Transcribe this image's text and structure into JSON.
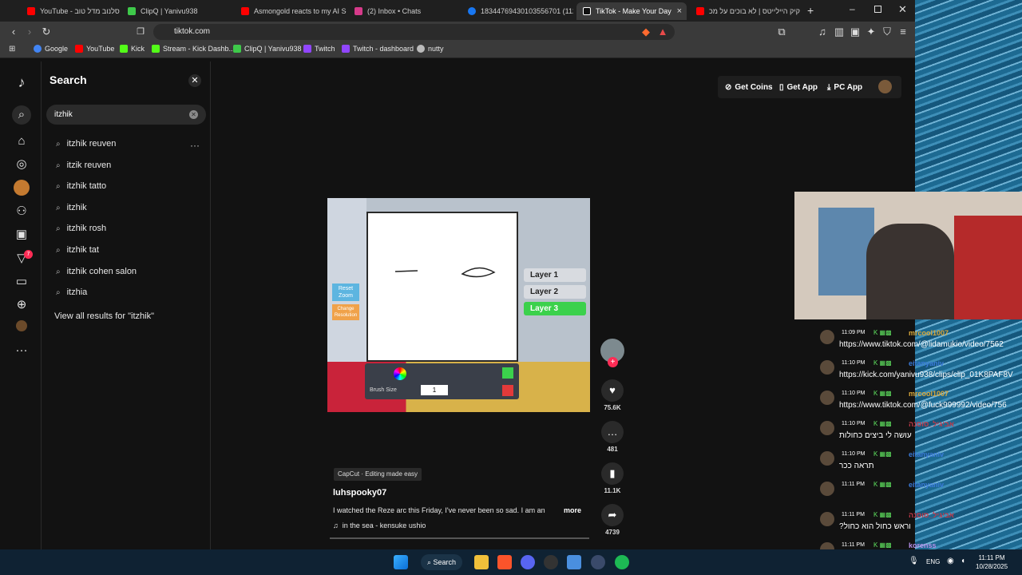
{
  "tabs": [
    {
      "label": "YouTube - גיא אסלנוב מדל טוב",
      "color": "#ff0000"
    },
    {
      "label": "ClipQ | Yanivu938",
      "color": "#3ec94a"
    },
    {
      "label": "Asmongold reacts to my AI So",
      "color": "#ff0000"
    },
    {
      "label": "(2) Inbox • Chats",
      "color": "#d63a8a"
    },
    {
      "label": "1834476943010355670​1 (112~",
      "color": "#1877f2"
    },
    {
      "label": "TikTok - Make Your Day",
      "color": "#ffffff"
    },
    {
      "label": "קיק היילייטס | לא בוכים על מכ",
      "color": "#ff0000"
    }
  ],
  "active_tab_close": "×",
  "address": {
    "url": "tiktok.com"
  },
  "bookmarks": [
    {
      "label": "Google",
      "color": "#4285f4"
    },
    {
      "label": "YouTube",
      "color": "#ff0000"
    },
    {
      "label": "Kick",
      "color": "#53fc18"
    },
    {
      "label": "Stream - Kick Dashb...",
      "color": "#53fc18"
    },
    {
      "label": "ClipQ | Yanivu938",
      "color": "#3ec94a"
    },
    {
      "label": "Twitch",
      "color": "#9146ff"
    },
    {
      "label": "Twitch - dashboard",
      "color": "#9146ff"
    },
    {
      "label": "nutty",
      "color": "#bbbbbb"
    }
  ],
  "rail": {
    "inbox_badge": "7"
  },
  "search": {
    "title": "Search",
    "query": "itzhik",
    "suggestions": [
      "itzhik reuven",
      "itzik reuven",
      "itzhik tatto",
      "itzhik",
      "itzhik rosh",
      "itzhik tat",
      "itzhik cohen salon",
      "itzhia"
    ],
    "view_all": "View all results for \"itzhik\""
  },
  "header": {
    "coins": "Get Coins",
    "app": "Get App",
    "pc_app": "PC App"
  },
  "video": {
    "layers": [
      "Layer 1",
      "Layer 2",
      "Layer 3"
    ],
    "reset_zoom": "Reset Zoom",
    "change_resolution": "Change Resolution",
    "brush_size_label": "Brush Size",
    "brush_size": "1"
  },
  "actions": {
    "likes": "75.6K",
    "comments": "481",
    "saves": "11.1K",
    "shares": "4739"
  },
  "post": {
    "capcut": "CapCut · Editing made easy",
    "author": "luhspooky07",
    "description": "I watched the Reze arc this Friday, I've never been so sad. I am an",
    "more": "more",
    "music": "in the sea - kensuke ushio"
  },
  "chat": [
    {
      "time": "11:09 PM",
      "name": "mrcool1007",
      "name_color": "#d9a83a",
      "text": "https://www.tiktok.com/@lidamukio/video/7562"
    },
    {
      "time": "11:10 PM",
      "name": "eitanyaniv",
      "name_color": "#3a7bd9",
      "text": "https://kick.com/yanivu938/clips/clip_01K8PAF8V"
    },
    {
      "time": "11:10 PM",
      "name": "mrcool1007",
      "name_color": "#d9a83a",
      "text": "https://www.tiktok.com/@fuck999992/video/756"
    },
    {
      "time": "11:10 PM",
      "name": "אביגיל_סוסנה",
      "name_color": "#c23a4a",
      "text": "עושה לי ביצים כחולות"
    },
    {
      "time": "11:10 PM",
      "name": "eitanyaniv",
      "name_color": "#3a7bd9",
      "text": "תראה ככר"
    },
    {
      "time": "11:11 PM",
      "name": "eitanyaniv",
      "name_color": "#3a7bd9",
      "text": ""
    },
    {
      "time": "11:11 PM",
      "name": "אביגיל_סוסנה",
      "name_color": "#c23a4a",
      "text": "?וראש כחול הוא כחול"
    },
    {
      "time": "11:11 PM",
      "name": "korenss",
      "name_color": "#b58ee8",
      "text": "חחחחחחחחחח"
    }
  ],
  "taskbar": {
    "search": "Search",
    "lang": "ENG",
    "time": "11:11 PM",
    "date": "10/28/2025"
  }
}
